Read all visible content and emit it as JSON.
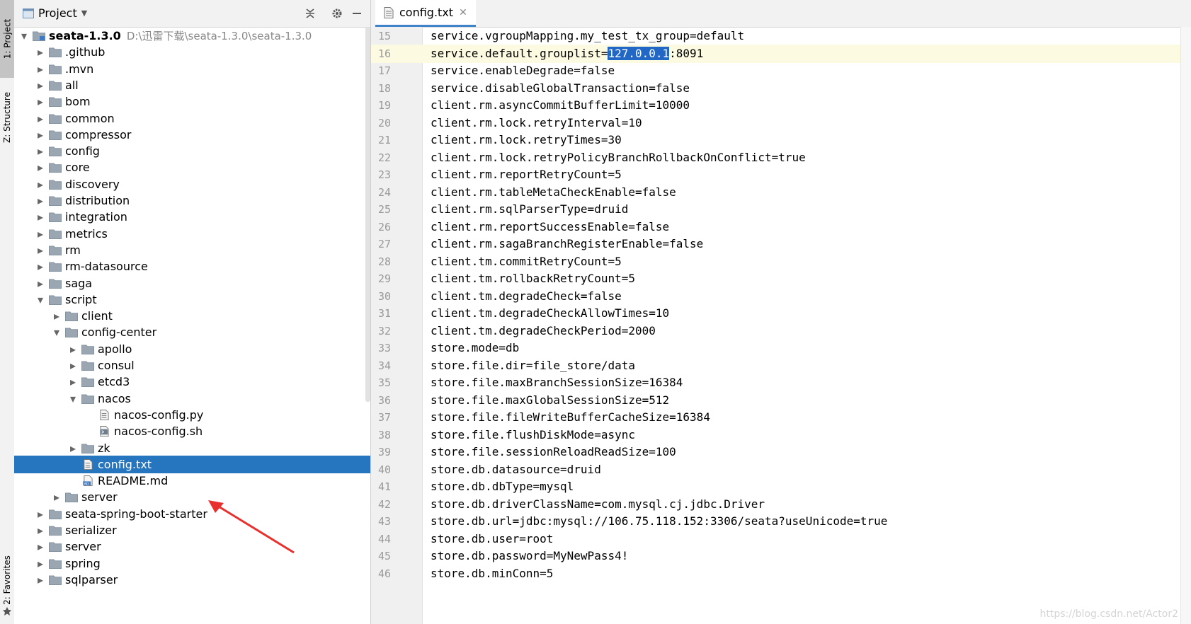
{
  "sidebar_strip": {
    "project_tab": "1: Project",
    "structure_tab": "Z: Structure",
    "favorites_tab": "2: Favorites"
  },
  "project_panel": {
    "title": "Project",
    "icons": [
      "dropdown-icon",
      "collapse-all-icon",
      "gear-icon",
      "minimize-icon"
    ],
    "root": {
      "name": "seata-1.3.0",
      "path": "D:\\迅雷下载\\seata-1.3.0\\seata-1.3.0"
    },
    "tree": [
      {
        "label": "seata-1.3.0",
        "indent": 0,
        "type": "root",
        "expanded": true
      },
      {
        "label": ".github",
        "indent": 1,
        "type": "folder"
      },
      {
        "label": ".mvn",
        "indent": 1,
        "type": "folder"
      },
      {
        "label": "all",
        "indent": 1,
        "type": "folder"
      },
      {
        "label": "bom",
        "indent": 1,
        "type": "folder"
      },
      {
        "label": "common",
        "indent": 1,
        "type": "folder"
      },
      {
        "label": "compressor",
        "indent": 1,
        "type": "folder"
      },
      {
        "label": "config",
        "indent": 1,
        "type": "folder"
      },
      {
        "label": "core",
        "indent": 1,
        "type": "folder"
      },
      {
        "label": "discovery",
        "indent": 1,
        "type": "folder"
      },
      {
        "label": "distribution",
        "indent": 1,
        "type": "folder"
      },
      {
        "label": "integration",
        "indent": 1,
        "type": "folder"
      },
      {
        "label": "metrics",
        "indent": 1,
        "type": "folder"
      },
      {
        "label": "rm",
        "indent": 1,
        "type": "folder"
      },
      {
        "label": "rm-datasource",
        "indent": 1,
        "type": "folder"
      },
      {
        "label": "saga",
        "indent": 1,
        "type": "folder"
      },
      {
        "label": "script",
        "indent": 1,
        "type": "folder",
        "expanded": true
      },
      {
        "label": "client",
        "indent": 2,
        "type": "folder"
      },
      {
        "label": "config-center",
        "indent": 2,
        "type": "folder",
        "expanded": true
      },
      {
        "label": "apollo",
        "indent": 3,
        "type": "folder"
      },
      {
        "label": "consul",
        "indent": 3,
        "type": "folder"
      },
      {
        "label": "etcd3",
        "indent": 3,
        "type": "folder"
      },
      {
        "label": "nacos",
        "indent": 3,
        "type": "folder",
        "expanded": true
      },
      {
        "label": "nacos-config.py",
        "indent": 4,
        "type": "file-py"
      },
      {
        "label": "nacos-config.sh",
        "indent": 4,
        "type": "file-sh"
      },
      {
        "label": "zk",
        "indent": 3,
        "type": "folder"
      },
      {
        "label": "config.txt",
        "indent": 3,
        "type": "file-txt",
        "selected": true
      },
      {
        "label": "README.md",
        "indent": 3,
        "type": "file-md"
      },
      {
        "label": "server",
        "indent": 2,
        "type": "folder"
      },
      {
        "label": "seata-spring-boot-starter",
        "indent": 1,
        "type": "folder"
      },
      {
        "label": "serializer",
        "indent": 1,
        "type": "folder"
      },
      {
        "label": "server",
        "indent": 1,
        "type": "folder"
      },
      {
        "label": "spring",
        "indent": 1,
        "type": "folder"
      },
      {
        "label": "sqlparser",
        "indent": 1,
        "type": "folder"
      }
    ]
  },
  "editor": {
    "tab_label": "config.txt",
    "current_line": 16,
    "highlight": {
      "line": 16,
      "before": "service.default.grouplist=",
      "selected": "127.0.0.1",
      "after": ":8091"
    },
    "lines": [
      {
        "n": "15",
        "text": "service.vgroupMapping.my_test_tx_group=default"
      },
      {
        "n": "16",
        "text": "service.default.grouplist=127.0.0.1:8091"
      },
      {
        "n": "17",
        "text": "service.enableDegrade=false"
      },
      {
        "n": "18",
        "text": "service.disableGlobalTransaction=false"
      },
      {
        "n": "19",
        "text": "client.rm.asyncCommitBufferLimit=10000"
      },
      {
        "n": "20",
        "text": "client.rm.lock.retryInterval=10"
      },
      {
        "n": "21",
        "text": "client.rm.lock.retryTimes=30"
      },
      {
        "n": "22",
        "text": "client.rm.lock.retryPolicyBranchRollbackOnConflict=true"
      },
      {
        "n": "23",
        "text": "client.rm.reportRetryCount=5"
      },
      {
        "n": "24",
        "text": "client.rm.tableMetaCheckEnable=false"
      },
      {
        "n": "25",
        "text": "client.rm.sqlParserType=druid"
      },
      {
        "n": "26",
        "text": "client.rm.reportSuccessEnable=false"
      },
      {
        "n": "27",
        "text": "client.rm.sagaBranchRegisterEnable=false"
      },
      {
        "n": "28",
        "text": "client.tm.commitRetryCount=5"
      },
      {
        "n": "29",
        "text": "client.tm.rollbackRetryCount=5"
      },
      {
        "n": "30",
        "text": "client.tm.degradeCheck=false"
      },
      {
        "n": "31",
        "text": "client.tm.degradeCheckAllowTimes=10"
      },
      {
        "n": "32",
        "text": "client.tm.degradeCheckPeriod=2000"
      },
      {
        "n": "33",
        "text": "store.mode=db"
      },
      {
        "n": "34",
        "text": "store.file.dir=file_store/data"
      },
      {
        "n": "35",
        "text": "store.file.maxBranchSessionSize=16384"
      },
      {
        "n": "36",
        "text": "store.file.maxGlobalSessionSize=512"
      },
      {
        "n": "37",
        "text": "store.file.fileWriteBufferCacheSize=16384"
      },
      {
        "n": "38",
        "text": "store.file.flushDiskMode=async"
      },
      {
        "n": "39",
        "text": "store.file.sessionReloadReadSize=100"
      },
      {
        "n": "40",
        "text": "store.db.datasource=druid"
      },
      {
        "n": "41",
        "text": "store.db.dbType=mysql"
      },
      {
        "n": "42",
        "text": "store.db.driverClassName=com.mysql.cj.jdbc.Driver"
      },
      {
        "n": "43",
        "text": "store.db.url=jdbc:mysql://106.75.118.152:3306/seata?useUnicode=true"
      },
      {
        "n": "44",
        "text": "store.db.user=root"
      },
      {
        "n": "45",
        "text": "store.db.password=MyNewPass4!"
      },
      {
        "n": "46",
        "text": "store.db.minConn=5"
      }
    ]
  },
  "watermark": "https://blog.csdn.net/Actor2",
  "colors": {
    "selection": "#2675bf",
    "text_highlight": "#2167c5",
    "current_line": "#fcfae1",
    "arrow": "#e8302f"
  }
}
